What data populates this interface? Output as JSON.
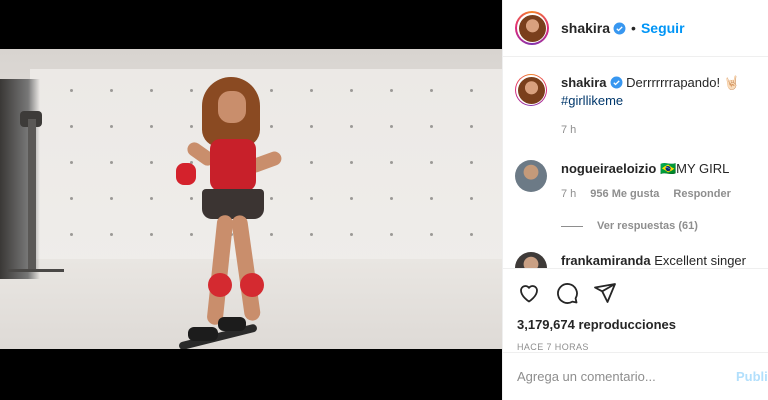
{
  "post": {
    "author": "shakira",
    "follow_label": "Seguir",
    "separator": "•"
  },
  "caption": {
    "author": "shakira",
    "text": "Derrrrrrrapando! 🤘🏻",
    "hashtag": "#girllikeme",
    "time": "7 h"
  },
  "comments": [
    {
      "author": "nogueiraeloizio",
      "text": "🇧🇷MY GIRL",
      "time": "7 h",
      "likes": "956 Me gusta",
      "reply_label": "Responder",
      "view_replies": "Ver respuestas (61)"
    },
    {
      "author": "frankamiranda",
      "text": "Excellent singer"
    }
  ],
  "stats": {
    "views": "3,179,674 reproducciones",
    "timestamp": "HACE 7 HORAS"
  },
  "comment_box": {
    "placeholder": "Agrega un comentario...",
    "publish_label": "Publicar"
  },
  "icons": {
    "like": "heart-icon",
    "comment": "comment-icon",
    "share": "send-icon",
    "mute": "volume-icon",
    "verified": "verified-badge-icon"
  },
  "colors": {
    "accent": "#0095f6",
    "verified": "#3897f0",
    "publish_disabled": "#b2dffc",
    "muted_text": "#8e8e8e"
  }
}
